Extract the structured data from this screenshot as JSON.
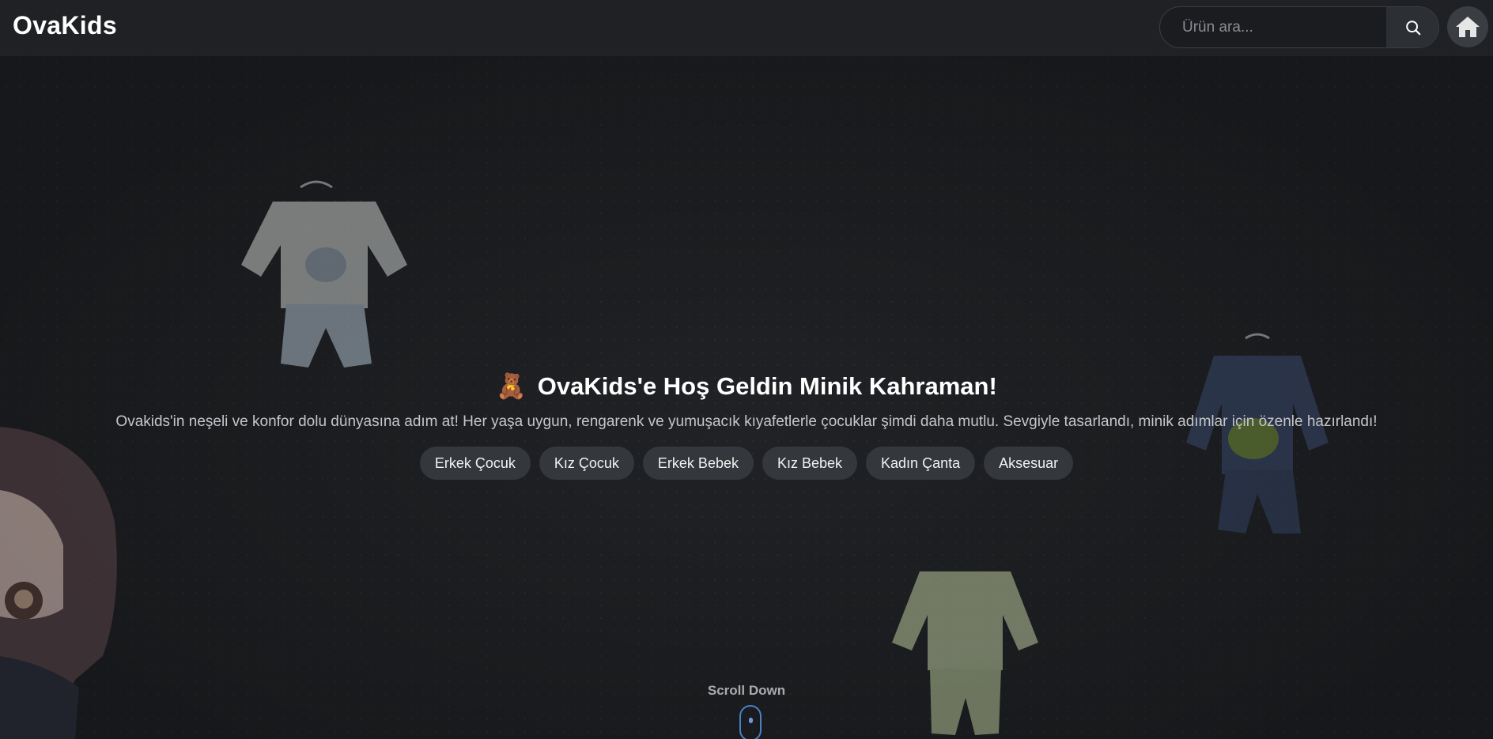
{
  "header": {
    "logo": "OvaKids",
    "search": {
      "placeholder": "Ürün ara...",
      "value": ""
    },
    "search_icon": "search-icon",
    "home_icon": "home-icon"
  },
  "hero": {
    "emoji": "🧸",
    "title": "OvaKids'e Hoş Geldin Minik Kahraman!",
    "subtitle": "Ovakids'in neşeli ve konfor dolu dünyasına adım at! Her yaşa uygun, rengarenk ve yumuşacık kıyafetlerle çocuklar şimdi daha mutlu. Sevgiyle tasarlandı, minik adımlar için özenle hazırlandı!",
    "categories": [
      "Erkek Çocuk",
      "Kız Çocuk",
      "Erkek Bebek",
      "Kız Bebek",
      "Kadın Çanta",
      "Aksesuar"
    ]
  },
  "scroll": {
    "label": "Scroll Down"
  },
  "colors": {
    "accent": "#4a7fc9",
    "background": "#1d1f22",
    "button": "#34373c"
  }
}
